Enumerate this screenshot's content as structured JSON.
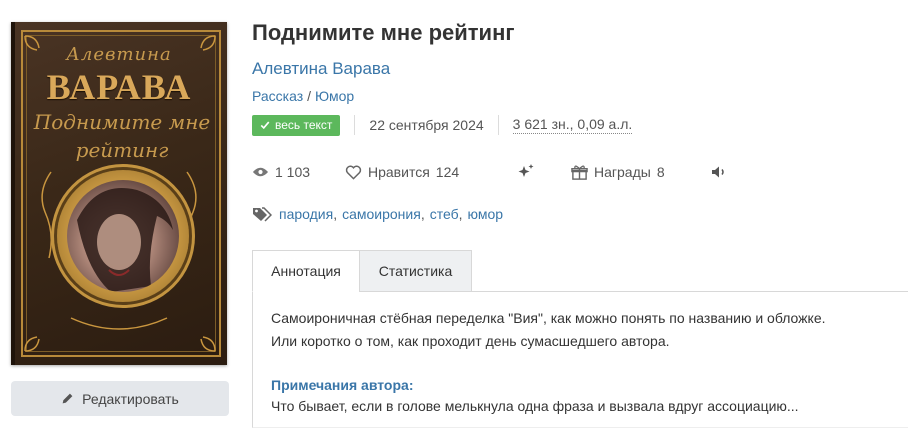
{
  "work": {
    "title": "Поднимите мне рейтинг",
    "author": "Алевтина Варава",
    "genre": [
      "Рассказ",
      "Юмор"
    ],
    "genre_separator": "/",
    "badge": "весь текст",
    "date": "22 сентября 2024",
    "size": "3 621 зн., 0,09 а.л."
  },
  "cover": {
    "author_script": "Алевтина",
    "author": "ВАРАВА",
    "title_script": "Поднимите мне рейтинг"
  },
  "stats": {
    "views": "1 103",
    "likes_label": "Нравится",
    "likes": "124",
    "awards_label": "Награды",
    "awards": "8"
  },
  "tags": [
    "пародия",
    "самоирония",
    "стеб",
    "юмор"
  ],
  "tabs": [
    {
      "label": "Аннотация",
      "active": true
    },
    {
      "label": "Статистика",
      "active": false
    }
  ],
  "annotation": {
    "lines": [
      "Самоироничная стёбная переделка \"Вия\", как можно понять по названию и обложке.",
      "Или коротко о том, как проходит день сумасшедшего автора."
    ],
    "notes_title": "Примечания автора:",
    "notes_text": "Что бывает, если в голове мелькнула одна фраза и вызвала вдруг ассоциацию..."
  },
  "actions": {
    "edit_label": "Редактировать"
  },
  "icons": [
    "pencil-icon",
    "check-icon",
    "eye-icon",
    "heart-icon",
    "sparkle-icon",
    "gift-icon",
    "speaker-icon",
    "tags-icon"
  ],
  "colors": {
    "link": "#3a76a8",
    "badge": "#5cb85c",
    "button_bg": "#e4e7eb"
  }
}
